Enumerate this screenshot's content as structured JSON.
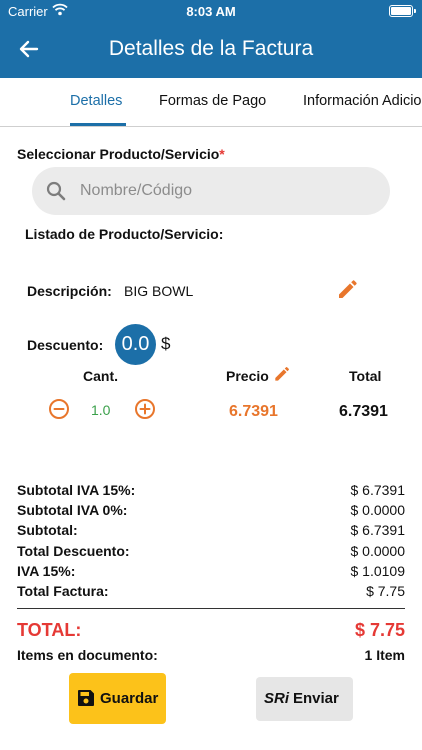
{
  "status_bar": {
    "carrier": "Carrier",
    "time": "8:03 AM"
  },
  "header": {
    "title": "Detalles de la Factura"
  },
  "tabs": [
    {
      "label": "Detalles",
      "active": true
    },
    {
      "label": "Formas de Pago",
      "active": false
    },
    {
      "label": "Información Adicional",
      "active": false
    }
  ],
  "product_select": {
    "label": "Seleccionar Producto/Servicio",
    "required_mark": "*",
    "search_placeholder": "Nombre/Código"
  },
  "product_list": {
    "title": "Listado de Producto/Servicio:",
    "description_label": "Descripción:",
    "description_value": "BIG BOWL",
    "discount_label": "Descuento:",
    "discount_value": "0.0",
    "discount_currency": "$",
    "columns": {
      "qty": "Cant.",
      "price": "Precio",
      "total": "Total"
    },
    "row": {
      "qty": "1.0",
      "price": "6.7391",
      "total": "6.7391"
    }
  },
  "summary": [
    {
      "label": "Subtotal IVA 15%:",
      "value": "$ 6.7391"
    },
    {
      "label": "Subtotal IVA 0%:",
      "value": "$ 0.0000"
    },
    {
      "label": "Subtotal:",
      "value": "$ 6.7391"
    },
    {
      "label": "Total Descuento:",
      "value": "$ 0.0000"
    },
    {
      "label": "IVA 15%:",
      "value": "$ 1.0109"
    },
    {
      "label": "Total Factura:",
      "value": "$ 7.75"
    }
  ],
  "grand_total": {
    "label": "TOTAL:",
    "value": "$ 7.75"
  },
  "items_in_document": {
    "label": "Items en documento:",
    "value": "1  Item"
  },
  "actions": {
    "save_label": "Guardar",
    "send_brand": "SRi",
    "send_label": "Enviar"
  },
  "colors": {
    "primary": "#1c6fa8",
    "accent_orange": "#e8762c",
    "total_red": "#e53935",
    "save_yellow": "#fcc21a",
    "qty_green": "#3aa04a"
  }
}
